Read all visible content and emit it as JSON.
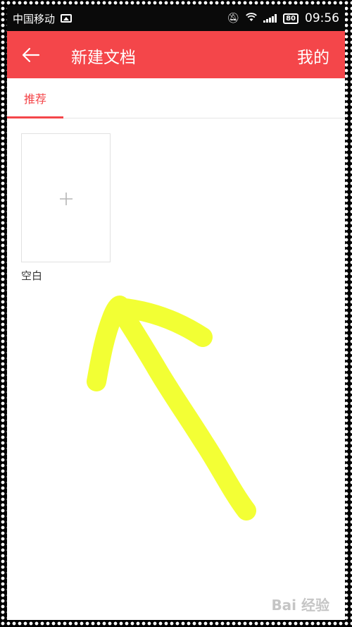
{
  "status_bar": {
    "carrier": "中国移动",
    "battery": "80",
    "time": "09:56"
  },
  "app_bar": {
    "title": "新建文档",
    "right_action": "我的"
  },
  "tabs": [
    {
      "label": "推荐",
      "active": true
    }
  ],
  "templates": [
    {
      "label": "空白"
    }
  ],
  "watermark": "Bai 经验",
  "colors": {
    "accent": "#f4464a",
    "annotation": "#f2ff2a"
  },
  "icons": {
    "back": "arrow-left-icon",
    "add": "plus-icon"
  }
}
